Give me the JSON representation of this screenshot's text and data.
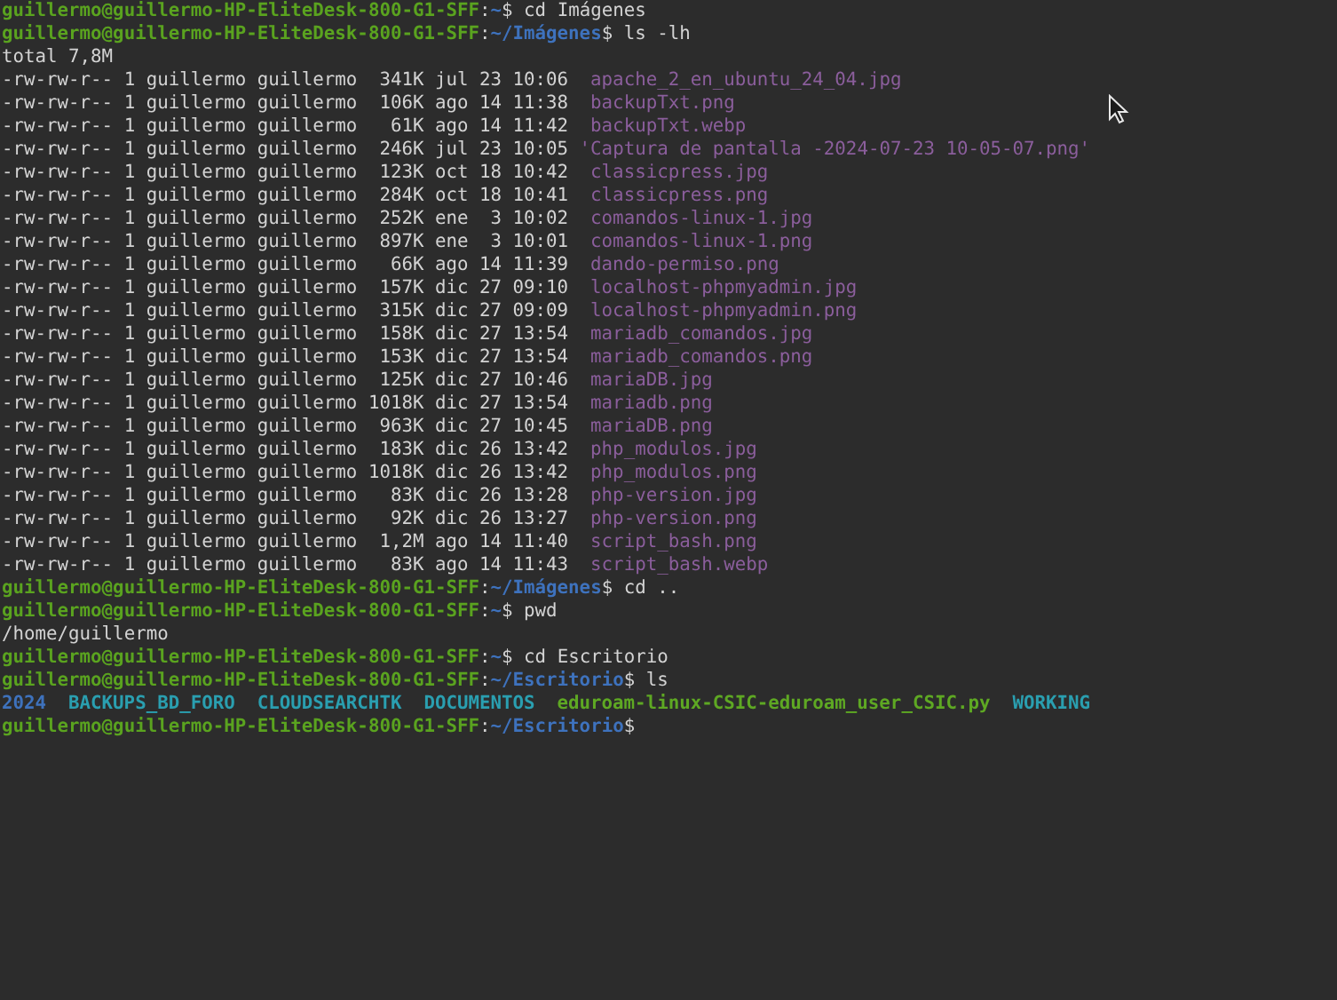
{
  "terminal": {
    "lines": [
      {
        "kind": "prompt",
        "user_host": "guillermo@guillermo-HP-EliteDesk-800-G1-SFF",
        "colon": ":",
        "path": "~",
        "sigil": "$",
        "command": "cd Imágenes"
      },
      {
        "kind": "prompt",
        "user_host": "guillermo@guillermo-HP-EliteDesk-800-G1-SFF",
        "colon": ":",
        "path": "~/Imágenes",
        "sigil": "$",
        "command": "ls -lh"
      },
      {
        "kind": "output",
        "text": "total 7,8M"
      },
      {
        "kind": "file",
        "info": "-rw-rw-r-- 1 guillermo guillermo  341K jul 23 10:06",
        "name": "apache_2_en_ubuntu_24_04.jpg"
      },
      {
        "kind": "file",
        "info": "-rw-rw-r-- 1 guillermo guillermo  106K ago 14 11:38",
        "name": "backupTxt.png"
      },
      {
        "kind": "file",
        "info": "-rw-rw-r-- 1 guillermo guillermo   61K ago 14 11:42",
        "name": "backupTxt.webp"
      },
      {
        "kind": "file",
        "info": "-rw-rw-r-- 1 guillermo guillermo  246K jul 23 10:05",
        "name": "'Captura de pantalla -2024-07-23 10-05-07.png'"
      },
      {
        "kind": "file",
        "info": "-rw-rw-r-- 1 guillermo guillermo  123K oct 18 10:42",
        "name": "classicpress.jpg"
      },
      {
        "kind": "file",
        "info": "-rw-rw-r-- 1 guillermo guillermo  284K oct 18 10:41",
        "name": "classicpress.png"
      },
      {
        "kind": "file",
        "info": "-rw-rw-r-- 1 guillermo guillermo  252K ene  3 10:02",
        "name": "comandos-linux-1.jpg"
      },
      {
        "kind": "file",
        "info": "-rw-rw-r-- 1 guillermo guillermo  897K ene  3 10:01",
        "name": "comandos-linux-1.png"
      },
      {
        "kind": "file",
        "info": "-rw-rw-r-- 1 guillermo guillermo   66K ago 14 11:39",
        "name": "dando-permiso.png"
      },
      {
        "kind": "file",
        "info": "-rw-rw-r-- 1 guillermo guillermo  157K dic 27 09:10",
        "name": "localhost-phpmyadmin.jpg"
      },
      {
        "kind": "file",
        "info": "-rw-rw-r-- 1 guillermo guillermo  315K dic 27 09:09",
        "name": "localhost-phpmyadmin.png"
      },
      {
        "kind": "file",
        "info": "-rw-rw-r-- 1 guillermo guillermo  158K dic 27 13:54",
        "name": "mariadb_comandos.jpg"
      },
      {
        "kind": "file",
        "info": "-rw-rw-r-- 1 guillermo guillermo  153K dic 27 13:54",
        "name": "mariadb_comandos.png"
      },
      {
        "kind": "file",
        "info": "-rw-rw-r-- 1 guillermo guillermo  125K dic 27 10:46",
        "name": "mariaDB.jpg"
      },
      {
        "kind": "file",
        "info": "-rw-rw-r-- 1 guillermo guillermo 1018K dic 27 13:54",
        "name": "mariadb.png"
      },
      {
        "kind": "file",
        "info": "-rw-rw-r-- 1 guillermo guillermo  963K dic 27 10:45",
        "name": "mariaDB.png"
      },
      {
        "kind": "file",
        "info": "-rw-rw-r-- 1 guillermo guillermo  183K dic 26 13:42",
        "name": "php_modulos.jpg"
      },
      {
        "kind": "file",
        "info": "-rw-rw-r-- 1 guillermo guillermo 1018K dic 26 13:42",
        "name": "php_modulos.png"
      },
      {
        "kind": "file",
        "info": "-rw-rw-r-- 1 guillermo guillermo   83K dic 26 13:28",
        "name": "php-version.jpg"
      },
      {
        "kind": "file",
        "info": "-rw-rw-r-- 1 guillermo guillermo   92K dic 26 13:27",
        "name": "php-version.png"
      },
      {
        "kind": "file",
        "info": "-rw-rw-r-- 1 guillermo guillermo  1,2M ago 14 11:40",
        "name": "script_bash.png"
      },
      {
        "kind": "file",
        "info": "-rw-rw-r-- 1 guillermo guillermo   83K ago 14 11:43",
        "name": "script_bash.webp"
      },
      {
        "kind": "prompt",
        "user_host": "guillermo@guillermo-HP-EliteDesk-800-G1-SFF",
        "colon": ":",
        "path": "~/Imágenes",
        "sigil": "$",
        "command": "cd .."
      },
      {
        "kind": "prompt",
        "user_host": "guillermo@guillermo-HP-EliteDesk-800-G1-SFF",
        "colon": ":",
        "path": "~",
        "sigil": "$",
        "command": "pwd"
      },
      {
        "kind": "output",
        "text": "/home/guillermo"
      },
      {
        "kind": "prompt",
        "user_host": "guillermo@guillermo-HP-EliteDesk-800-G1-SFF",
        "colon": ":",
        "path": "~",
        "sigil": "$",
        "command": "cd Escritorio"
      },
      {
        "kind": "prompt",
        "user_host": "guillermo@guillermo-HP-EliteDesk-800-G1-SFF",
        "colon": ":",
        "path": "~/Escritorio",
        "sigil": "$",
        "command": "ls"
      },
      {
        "kind": "entries",
        "items": [
          {
            "name": "2024",
            "color": "#3e72bd"
          },
          {
            "name": "BACKUPS_BD_FORO",
            "color": "#2a9fb0"
          },
          {
            "name": "CLOUDSEARCHTK",
            "color": "#2a9fb0"
          },
          {
            "name": "DOCUMENTOS",
            "color": "#2a9fb0"
          },
          {
            "name": "eduroam-linux-CSIC-eduroam_user_CSIC.py",
            "color": "#5ea823"
          },
          {
            "name": "WORKING",
            "color": "#2a9fb0"
          }
        ]
      },
      {
        "kind": "prompt",
        "user_host": "guillermo@guillermo-HP-EliteDesk-800-G1-SFF",
        "colon": ":",
        "path": "~/Escritorio",
        "sigil": "$"
      }
    ]
  }
}
